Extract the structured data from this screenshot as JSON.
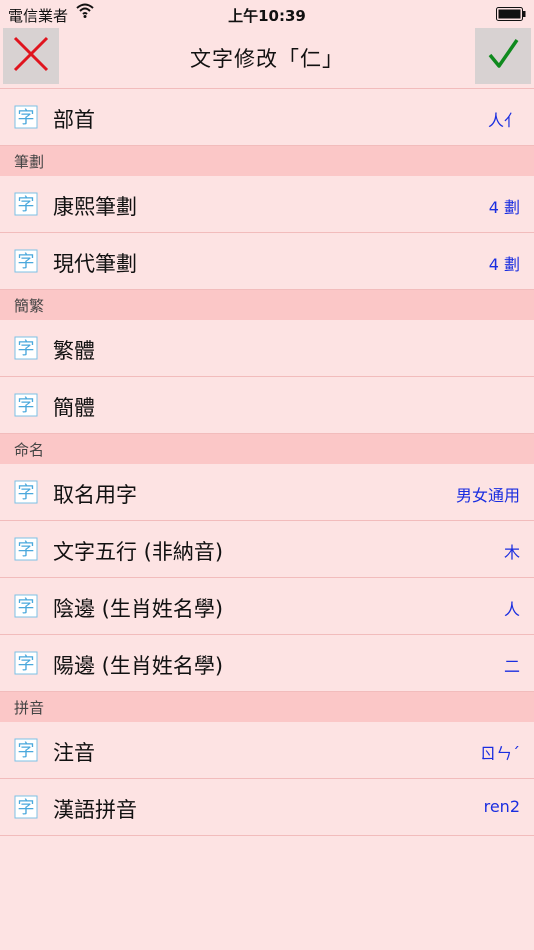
{
  "status_bar": {
    "carrier": "電信業者",
    "time": "上午10:39"
  },
  "nav": {
    "title": "文字修改「仁」"
  },
  "groups": [
    {
      "section": "",
      "rows": [
        {
          "label": "部首",
          "value": "人亻"
        }
      ]
    },
    {
      "section": "筆劃",
      "rows": [
        {
          "label": "康熙筆劃",
          "value": "4 劃"
        },
        {
          "label": "現代筆劃",
          "value": "4 劃"
        }
      ]
    },
    {
      "section": "簡繁",
      "rows": [
        {
          "label": "繁體",
          "value": ""
        },
        {
          "label": "簡體",
          "value": ""
        }
      ]
    },
    {
      "section": "命名",
      "rows": [
        {
          "label": "取名用字",
          "value": "男女通用"
        },
        {
          "label": "文字五行 (非納音)",
          "value": "木"
        },
        {
          "label": "陰邊 (生肖姓名學)",
          "value": "人"
        },
        {
          "label": "陽邊 (生肖姓名學)",
          "value": "二"
        }
      ]
    },
    {
      "section": "拼音",
      "rows": [
        {
          "label": "注音",
          "value": "ㄖㄣˊ"
        },
        {
          "label": "漢語拼音",
          "value": "ren2"
        }
      ]
    }
  ],
  "colors": {
    "accent_value": "#1a2ee0",
    "cancel": "#e0141e",
    "confirm": "#0f8a1e",
    "icon": "#4aa8dc"
  }
}
